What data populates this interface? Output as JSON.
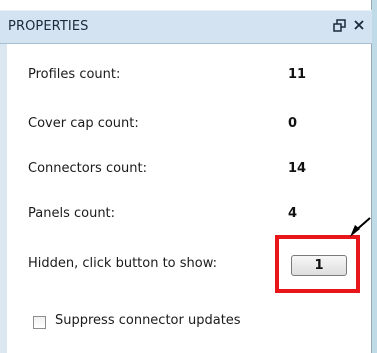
{
  "panel": {
    "title": "PROPERTIES",
    "pin_icon": "pin-icon",
    "close_icon": "close-icon"
  },
  "rows": [
    {
      "label": "Profiles count:",
      "value": "11"
    },
    {
      "label": "Cover cap count:",
      "value": "0"
    },
    {
      "label": "Connectors count:",
      "value": "14"
    },
    {
      "label": "Panels count:",
      "value": "4"
    }
  ],
  "hidden": {
    "label": "Hidden, click button to show:",
    "button_label": "1"
  },
  "suppress": {
    "label": "Suppress connector updates",
    "checked": false
  },
  "colors": {
    "highlight": "#e8161b",
    "title_bar": "#d3e3f1",
    "background": "#bfdbe8"
  }
}
